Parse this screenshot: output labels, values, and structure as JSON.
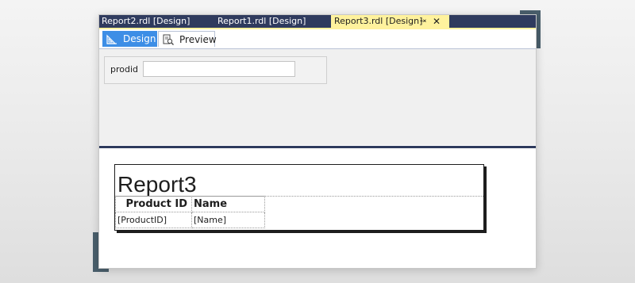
{
  "document_tabs": [
    {
      "label": "Report2.rdl [Design]",
      "active": false
    },
    {
      "label": "Report1.rdl [Design]",
      "active": false
    },
    {
      "label": "Report3.rdl [Design]",
      "active": true
    }
  ],
  "document_tab_icons": {
    "pin": "pin-icon",
    "close": "close-icon"
  },
  "view_tabs": [
    {
      "label": "Design",
      "icon": "design-icon",
      "active": true
    },
    {
      "label": "Preview",
      "icon": "preview-icon",
      "active": false
    }
  ],
  "parameters": [
    {
      "label": "prodid",
      "value": "",
      "placeholder": ""
    }
  ],
  "report": {
    "title": "Report3",
    "table": {
      "headers": [
        "Product ID",
        "Name"
      ],
      "rows": [
        [
          "[ProductID]",
          "[Name]"
        ]
      ]
    }
  },
  "colors": {
    "tab_strip": "#2f3b5e",
    "active_tab": "#fff29d",
    "design_tab": "#3d8ee6",
    "frame_accent": "#4a5f6c"
  }
}
